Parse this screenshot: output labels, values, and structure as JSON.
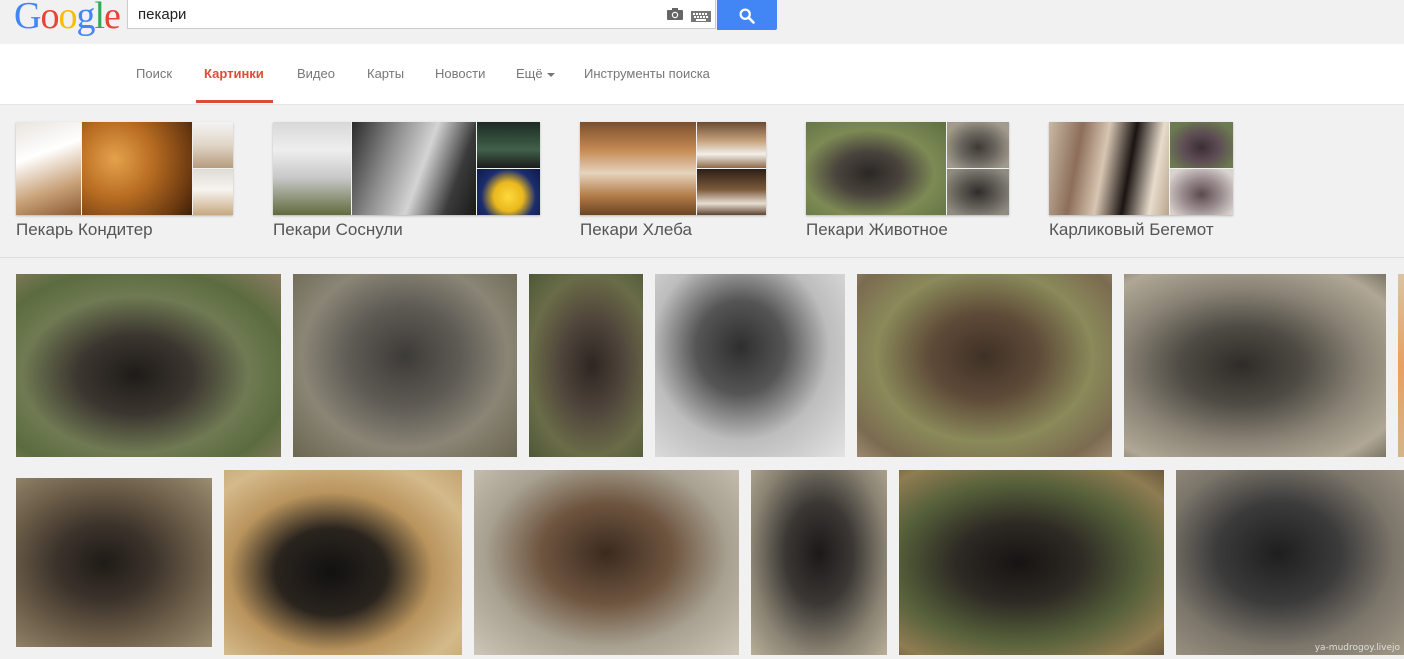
{
  "logo": {
    "letters": [
      "G",
      "o",
      "o",
      "g",
      "l",
      "e"
    ],
    "colors": [
      "#4285f4",
      "#ea4335",
      "#fbbc05",
      "#4285f4",
      "#34a853",
      "#ea4335"
    ]
  },
  "search": {
    "query": "пекари"
  },
  "nav": {
    "items": [
      "Поиск",
      "Картинки",
      "Видео",
      "Карты",
      "Новости",
      "Ещё",
      "Инструменты поиска"
    ],
    "active_index": 1
  },
  "related": [
    {
      "label": "Пекарь Кондитер"
    },
    {
      "label": "Пекари Соснули"
    },
    {
      "label": "Пекари Хлеба"
    },
    {
      "label": "Пекари Животное"
    },
    {
      "label": "Карликовый Бегемот"
    }
  ],
  "watermark": "ya-mudrogoy.livejo",
  "colors": {
    "accent": "#dd4b39",
    "search_button": "#4285f4"
  }
}
